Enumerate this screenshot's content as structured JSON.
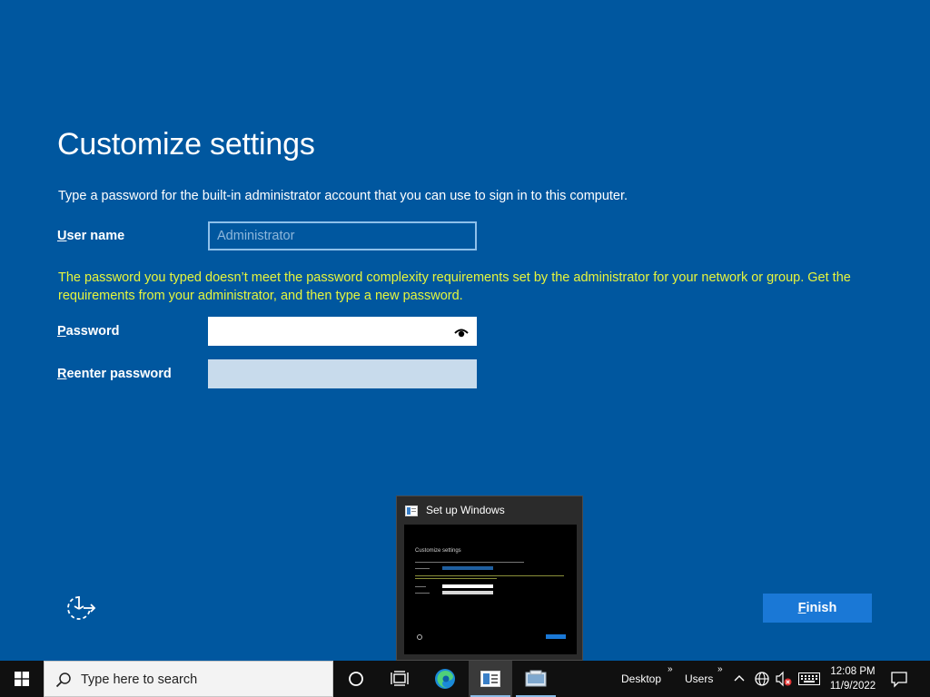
{
  "page": {
    "title": "Customize settings",
    "description": "Type a password for the built-in administrator account that you can use to sign in to this computer.",
    "username_label_first": "U",
    "username_label_rest": "ser name",
    "username_value": "Administrator",
    "warning": "The password you typed doesn’t meet the password complexity requirements set by the administrator for your network or group. Get the requirements from your administrator, and then type a new password.",
    "password_label_first": "P",
    "password_label_rest": "assword",
    "password_value": "",
    "reenter_label_first": "R",
    "reenter_label_rest": "eenter password",
    "reenter_value": "",
    "finish_first": "F",
    "finish_rest": "inish"
  },
  "thumbnail": {
    "title": "Set up Windows",
    "preview_title": "Customize settings"
  },
  "taskbar": {
    "search_placeholder": "Type here to search",
    "toolbar_desktop": "Desktop",
    "toolbar_users": "Users",
    "chevron": "»",
    "time": "12:08 PM",
    "date": "11/9/2022"
  },
  "colors": {
    "background": "#00579f",
    "warning_text": "#e6f53d",
    "finish_button": "#1a78d6",
    "taskbar": "#101010"
  },
  "icons": [
    "accessibility-icon",
    "reveal-password-icon",
    "windows-logo-icon",
    "search-icon",
    "cortana-icon",
    "task-view-icon",
    "edge-icon",
    "setup-app-icon",
    "explorer-app-icon",
    "tray-chevron-icon",
    "network-icon",
    "volume-muted-icon",
    "keyboard-icon",
    "notification-icon"
  ]
}
